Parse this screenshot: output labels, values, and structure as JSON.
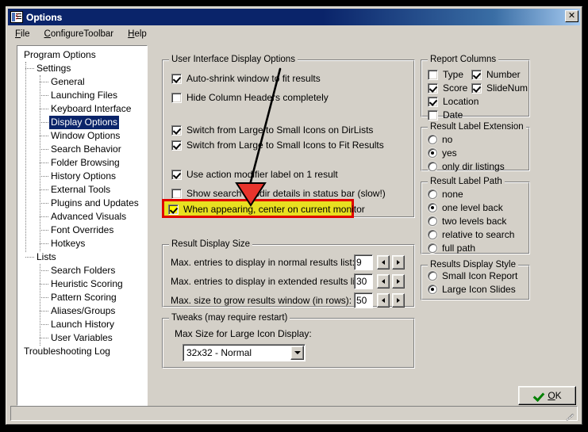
{
  "window": {
    "title": "Options",
    "icon": "options-checklist-icon",
    "close_label": "✕"
  },
  "menubar": {
    "items": [
      {
        "label": "File",
        "accel": "F"
      },
      {
        "label": "ConfigureToolbar",
        "accel": "C"
      },
      {
        "label": "Help",
        "accel": "H"
      }
    ]
  },
  "tree": {
    "nodes": [
      {
        "label": "Program Options",
        "depth": 0,
        "selected": false
      },
      {
        "label": "Settings",
        "depth": 1,
        "selected": false
      },
      {
        "label": "General",
        "depth": 2,
        "selected": false
      },
      {
        "label": "Launching Files",
        "depth": 2,
        "selected": false
      },
      {
        "label": "Keyboard Interface",
        "depth": 2,
        "selected": false
      },
      {
        "label": "Display Options",
        "depth": 2,
        "selected": true
      },
      {
        "label": "Window Options",
        "depth": 2,
        "selected": false
      },
      {
        "label": "Search Behavior",
        "depth": 2,
        "selected": false
      },
      {
        "label": "Folder Browsing",
        "depth": 2,
        "selected": false
      },
      {
        "label": "History Options",
        "depth": 2,
        "selected": false
      },
      {
        "label": "External Tools",
        "depth": 2,
        "selected": false
      },
      {
        "label": "Plugins and Updates",
        "depth": 2,
        "selected": false
      },
      {
        "label": "Advanced Visuals",
        "depth": 2,
        "selected": false
      },
      {
        "label": "Font Overrides",
        "depth": 2,
        "selected": false
      },
      {
        "label": "Hotkeys",
        "depth": 2,
        "selected": false
      },
      {
        "label": "Lists",
        "depth": 1,
        "selected": false
      },
      {
        "label": "Search Folders",
        "depth": 2,
        "selected": false
      },
      {
        "label": "Heuristic Scoring",
        "depth": 2,
        "selected": false
      },
      {
        "label": "Pattern Scoring",
        "depth": 2,
        "selected": false
      },
      {
        "label": "Aliases/Groups",
        "depth": 2,
        "selected": false
      },
      {
        "label": "Launch History",
        "depth": 2,
        "selected": false
      },
      {
        "label": "User Variables",
        "depth": 2,
        "selected": false
      },
      {
        "label": "Troubleshooting Log",
        "depth": 0,
        "selected": false
      }
    ]
  },
  "ui_display_options": {
    "title": "User Interface Display Options",
    "checkboxes": [
      {
        "label": "Auto-shrink window to fit results",
        "checked": true
      },
      {
        "label": "Hide Column Headers completely",
        "checked": false
      },
      {
        "label": "Switch from Large to Small Icons on DirLists",
        "checked": true
      },
      {
        "label": "Switch from Large to Small Icons to Fit Results",
        "checked": true
      },
      {
        "label": "Use action modifier label on 1 result",
        "checked": true
      },
      {
        "label": "Show search subdir details in status bar (slow!)",
        "checked": false
      }
    ],
    "highlighted": {
      "label": "When appearing, center on current monitor",
      "checked": true
    }
  },
  "result_display_size": {
    "title": "Result Display Size",
    "fields": [
      {
        "label": "Max. entries to display in normal results list:",
        "value": "9"
      },
      {
        "label": "Max. entries to display in extended results list:",
        "value": "30"
      },
      {
        "label": "Max. size to grow results window (in rows):",
        "value": "50"
      }
    ]
  },
  "tweaks": {
    "title": "Tweaks (may require restart)",
    "label": "Max Size for Large Icon Display:",
    "combo_value": "32x32 - Normal"
  },
  "report_columns": {
    "title": "Report Columns",
    "items": [
      {
        "label": "Type",
        "checked": false
      },
      {
        "label": "Number",
        "checked": true
      },
      {
        "label": "Score",
        "checked": true
      },
      {
        "label": "SlideNum",
        "checked": true
      },
      {
        "label": "Location",
        "checked": true
      },
      {
        "label": "Date",
        "checked": false
      }
    ]
  },
  "result_label_extension": {
    "title": "Result Label Extension",
    "options": [
      {
        "label": "no",
        "selected": false
      },
      {
        "label": "yes",
        "selected": true
      },
      {
        "label": "only dir listings",
        "selected": false
      }
    ]
  },
  "result_label_path": {
    "title": "Result Label Path",
    "options": [
      {
        "label": "none",
        "selected": false
      },
      {
        "label": "one level back",
        "selected": true
      },
      {
        "label": "two levels back",
        "selected": false
      },
      {
        "label": "relative to search",
        "selected": false
      },
      {
        "label": "full path",
        "selected": false
      }
    ]
  },
  "results_display_style": {
    "title": "Results Display Style",
    "options": [
      {
        "label": "Small Icon Report",
        "selected": false
      },
      {
        "label": "Large Icon Slides",
        "selected": true
      }
    ]
  },
  "ok_button": {
    "label": "OK",
    "accel": "O",
    "icon": "green-check-icon"
  },
  "annotation": {
    "type": "arrow",
    "color": "#e00000",
    "line_color": "#000000"
  },
  "colors": {
    "face": "#d4d0c8",
    "titlebar": "#0a246a",
    "selection": "#0a246a",
    "highlight_fill": "#e8e020",
    "highlight_border": "#e00000"
  }
}
